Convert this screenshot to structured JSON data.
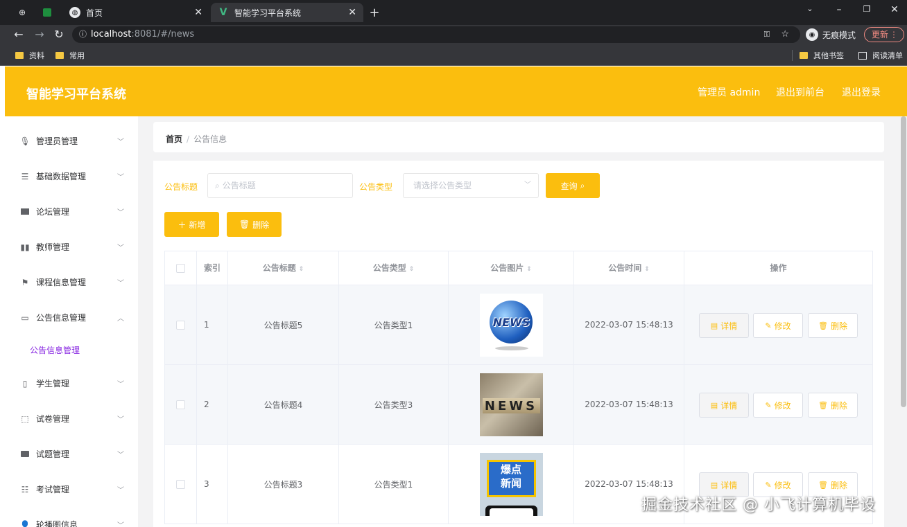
{
  "browser": {
    "tabs": [
      {
        "label": "首页"
      },
      {
        "label": "智能学习平台系统"
      }
    ],
    "url_host": "localhost",
    "url_rest": ":8081/#/news",
    "incognito_label": "无痕模式",
    "update_label": "更新",
    "bookmarks": [
      "资料",
      "常用"
    ],
    "bookmarks_right": [
      "其他书签",
      "阅读清单"
    ]
  },
  "header": {
    "title": "智能学习平台系统",
    "admin_label": "管理员 admin",
    "to_front": "退出到前台",
    "logout": "退出登录"
  },
  "sidebar": {
    "items": [
      {
        "label": "管理员管理",
        "icon": "microphone-icon"
      },
      {
        "label": "基础数据管理",
        "icon": "list-icon"
      },
      {
        "label": "论坛管理",
        "icon": "monitor-icon"
      },
      {
        "label": "教师管理",
        "icon": "bar-chart-icon"
      },
      {
        "label": "课程信息管理",
        "icon": "flag-icon"
      },
      {
        "label": "公告信息管理",
        "icon": "message-icon"
      },
      {
        "label": "学生管理",
        "icon": "phone-icon"
      },
      {
        "label": "试卷管理",
        "icon": "data-line-icon"
      },
      {
        "label": "试题管理",
        "icon": "printer-icon"
      },
      {
        "label": "考试管理",
        "icon": "operation-icon"
      },
      {
        "label": "轮播图信息",
        "icon": "user-icon"
      }
    ],
    "active_sub": "公告信息管理"
  },
  "breadcrumb": {
    "home": "首页",
    "separator": "/",
    "current": "公告信息"
  },
  "filters": {
    "title_label": "公告标题",
    "title_placeholder": "公告标题",
    "type_label": "公告类型",
    "type_placeholder": "请选择公告类型",
    "query_button": "查询"
  },
  "actions": {
    "add": "新增",
    "delete": "删除"
  },
  "table": {
    "columns": [
      "索引",
      "公告标题",
      "公告类型",
      "公告图片",
      "公告时间",
      "操作"
    ],
    "rows": [
      {
        "index": "1",
        "title": "公告标题5",
        "type": "公告类型1",
        "time": "2022-03-07 15:48:13",
        "image": "globe-news"
      },
      {
        "index": "2",
        "title": "公告标题4",
        "type": "公告类型3",
        "time": "2022-03-07 15:48:13",
        "image": "wood-news"
      },
      {
        "index": "3",
        "title": "公告标题3",
        "type": "公告类型1",
        "time": "2022-03-07 15:48:13",
        "image": "hot-news"
      }
    ],
    "row_actions": {
      "detail": "详情",
      "edit": "修改",
      "delete": "删除"
    },
    "image_texts": {
      "globe": "NEWS",
      "wood": "NEWS",
      "hot_line1": "爆点",
      "hot_line2": "新闻"
    }
  },
  "watermark": "掘金技术社区 @ 小飞计算机毕设",
  "colors": {
    "accent": "#fbbe0e",
    "sub_active": "#8a2be2"
  }
}
